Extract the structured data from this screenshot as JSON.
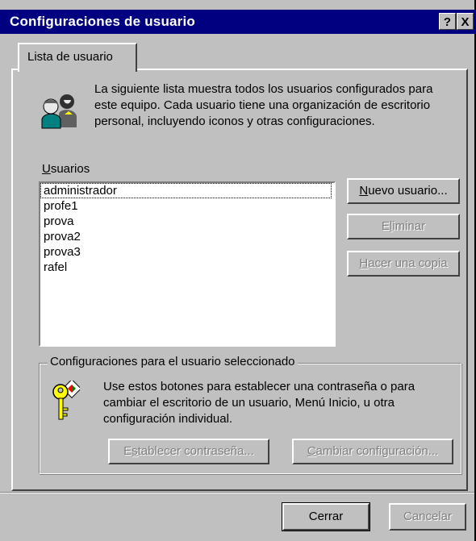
{
  "window": {
    "title": "Configuraciones de usuario",
    "help_label": "?",
    "close_label": "X"
  },
  "tab": {
    "label": "Lista de usuario"
  },
  "intro": {
    "text": "La siguiente lista muestra todos los usuarios configurados para este equipo. Cada usuario tiene una organización de escritorio personal, incluyendo iconos y otras configuraciones.",
    "icon": "users-icon"
  },
  "users": {
    "label_access_key": "U",
    "label_rest": "suarios",
    "items": [
      "administrador",
      "profe1",
      "prova",
      "prova2",
      "prova3",
      "rafel"
    ],
    "focused_index": 0
  },
  "buttons": {
    "new_user": {
      "key": "N",
      "rest": "uevo usuario..."
    },
    "delete": {
      "pre": "E",
      "key": "l",
      "rest": "iminar"
    },
    "copy": {
      "key": "H",
      "rest": "acer una copia"
    }
  },
  "group": {
    "legend": "Configuraciones para el usuario seleccionado",
    "icon": "keys-icon",
    "text": "Use estos botones para establecer una contraseña o para cambiar el escritorio de un usuario, Menú Inicio, u otra configuración individual.",
    "set_password": {
      "pre": "E",
      "key": "s",
      "rest": "tablecer contraseña..."
    },
    "change_settings": {
      "key": "C",
      "rest": "ambiar configuración..."
    }
  },
  "footer": {
    "close_label": "Cerrar",
    "cancel_label": "Cancelar"
  },
  "colors": {
    "titlebar": "#000080",
    "face": "#c0c0c0",
    "disabled_text": "#808080"
  }
}
